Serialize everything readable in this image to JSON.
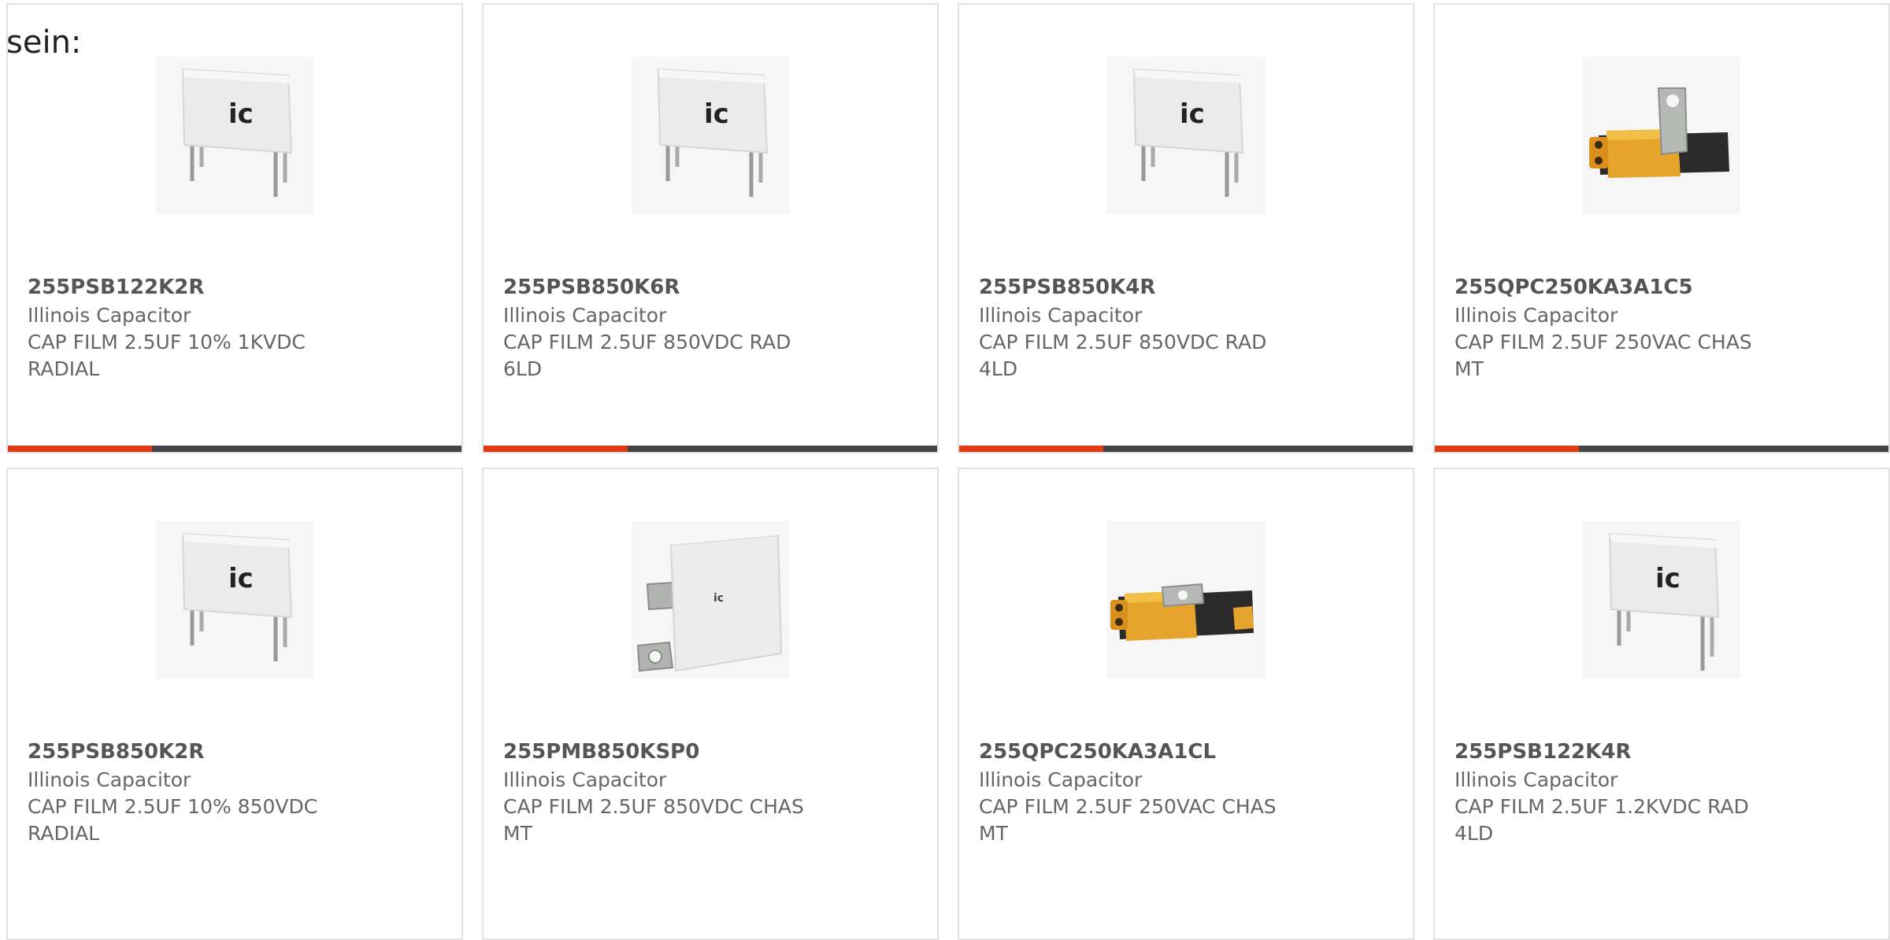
{
  "intro_text": "sein:",
  "colors": {
    "accent": "#e03b14",
    "bar": "#444444",
    "border": "#e1e1e1"
  },
  "products": [
    {
      "part_number": "255PSB122K2R",
      "manufacturer": "Illinois Capacitor",
      "description": "CAP FILM 2.5UF 10% 1KVDC\nRADIAL",
      "image": "radial-box-capacitor-icon"
    },
    {
      "part_number": "255PSB850K6R",
      "manufacturer": "Illinois Capacitor",
      "description": "CAP FILM 2.5UF 850VDC RAD\n6LD",
      "image": "radial-box-capacitor-icon"
    },
    {
      "part_number": "255PSB850K4R",
      "manufacturer": "Illinois Capacitor",
      "description": "CAP FILM 2.5UF 850VDC RAD\n4LD",
      "image": "radial-box-capacitor-icon"
    },
    {
      "part_number": "255QPC250KA3A1C5",
      "manufacturer": "Illinois Capacitor",
      "description": "CAP FILM 2.5UF 250VAC CHAS\nMT",
      "image": "chassis-mount-capacitor-icon"
    },
    {
      "part_number": "255PSB850K2R",
      "manufacturer": "Illinois Capacitor",
      "description": "CAP FILM 2.5UF 10% 850VDC\nRADIAL",
      "image": "radial-box-capacitor-icon"
    },
    {
      "part_number": "255PMB850KSP0",
      "manufacturer": "Illinois Capacitor",
      "description": "CAP FILM 2.5UF 850VDC CHAS\nMT",
      "image": "bracket-mount-capacitor-icon"
    },
    {
      "part_number": "255QPC250KA3A1CL",
      "manufacturer": "Illinois Capacitor",
      "description": "CAP FILM 2.5UF 250VAC CHAS\nMT",
      "image": "chassis-mount-capacitor-icon"
    },
    {
      "part_number": "255PSB122K4R",
      "manufacturer": "Illinois Capacitor",
      "description": "CAP FILM 2.5UF 1.2KVDC RAD\n4LD",
      "image": "radial-box-capacitor-icon"
    }
  ]
}
